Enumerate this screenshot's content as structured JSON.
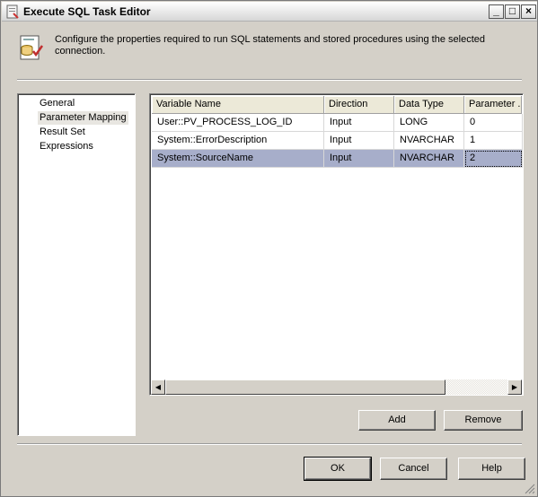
{
  "window": {
    "title": "Execute SQL Task Editor",
    "controls": {
      "minimize": "_",
      "maximize": "□",
      "close": "×"
    }
  },
  "header": {
    "description": "Configure the properties required to run SQL statements and stored procedures using the selected connection."
  },
  "nav": {
    "items": [
      {
        "label": "General",
        "selected": false
      },
      {
        "label": "Parameter Mapping",
        "selected": true
      },
      {
        "label": "Result Set",
        "selected": false
      },
      {
        "label": "Expressions",
        "selected": false
      }
    ]
  },
  "grid": {
    "columns": [
      "Variable Name",
      "Direction",
      "Data Type",
      "Parameter ..."
    ],
    "rows": [
      {
        "variable": "User::PV_PROCESS_LOG_ID",
        "direction": "Input",
        "type": "LONG",
        "param": "0",
        "selected": false
      },
      {
        "variable": "System::ErrorDescription",
        "direction": "Input",
        "type": "NVARCHAR",
        "param": "1",
        "selected": false
      },
      {
        "variable": "System::SourceName",
        "direction": "Input",
        "type": "NVARCHAR",
        "param": "2",
        "selected": true
      }
    ]
  },
  "buttons": {
    "add": "Add",
    "remove": "Remove",
    "ok": "OK",
    "cancel": "Cancel",
    "help": "Help"
  }
}
